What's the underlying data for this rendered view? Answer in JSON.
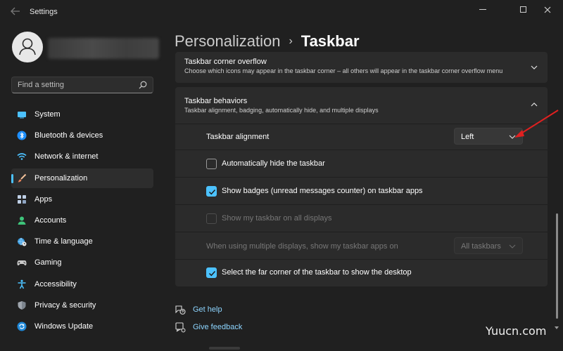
{
  "window": {
    "title": "Settings"
  },
  "search": {
    "placeholder": "Find a setting"
  },
  "sidebar": {
    "items": [
      {
        "label": "System",
        "icon": "monitor-icon"
      },
      {
        "label": "Bluetooth & devices",
        "icon": "bluetooth-icon"
      },
      {
        "label": "Network & internet",
        "icon": "wifi-icon"
      },
      {
        "label": "Personalization",
        "icon": "brush-icon",
        "selected": true
      },
      {
        "label": "Apps",
        "icon": "apps-icon"
      },
      {
        "label": "Accounts",
        "icon": "person-icon"
      },
      {
        "label": "Time & language",
        "icon": "globe-clock-icon"
      },
      {
        "label": "Gaming",
        "icon": "gamepad-icon"
      },
      {
        "label": "Accessibility",
        "icon": "accessibility-icon"
      },
      {
        "label": "Privacy & security",
        "icon": "shield-icon"
      },
      {
        "label": "Windows Update",
        "icon": "update-icon"
      }
    ]
  },
  "breadcrumb": {
    "parent": "Personalization",
    "separator": "›",
    "current": "Taskbar"
  },
  "corner_overflow": {
    "title": "Taskbar corner overflow",
    "description": "Choose which icons may appear in the taskbar corner – all others will appear in the taskbar corner overflow menu"
  },
  "behaviors": {
    "title": "Taskbar behaviors",
    "description": "Taskbar alignment, badging, automatically hide, and multiple displays",
    "alignment": {
      "label": "Taskbar alignment",
      "value": "Left"
    },
    "auto_hide": {
      "label": "Automatically hide the taskbar",
      "checked": false
    },
    "badges": {
      "label": "Show badges (unread messages counter) on taskbar apps",
      "checked": true
    },
    "all_displays": {
      "label": "Show my taskbar on all displays",
      "checked": false,
      "disabled": true
    },
    "multi_display": {
      "label": "When using multiple displays, show my taskbar apps on",
      "value": "All taskbars",
      "disabled": true
    },
    "far_corner": {
      "label": "Select the far corner of the taskbar to show the desktop",
      "checked": true
    }
  },
  "links": {
    "help": "Get help",
    "feedback": "Give feedback"
  },
  "watermark": "Yuucn.com",
  "colors": {
    "accent": "#4cc2ff",
    "background": "#202020",
    "card": "#2b2b2b",
    "annotation": "#e02020"
  }
}
